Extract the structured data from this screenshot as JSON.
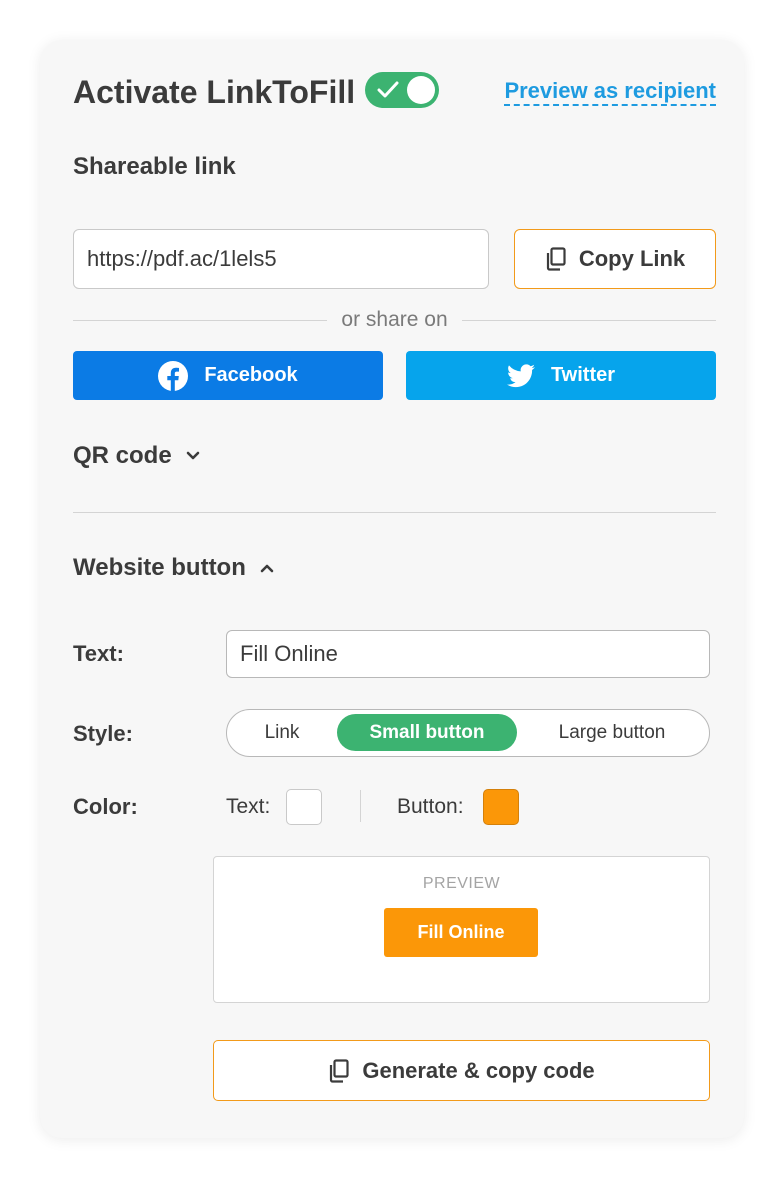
{
  "header": {
    "title": "Activate LinkToFill",
    "toggle_on": true,
    "preview_link": "Preview as recipient"
  },
  "shareable": {
    "heading": "Shareable link",
    "url": "https://pdf.ac/1lels5",
    "copy_label": "Copy Link",
    "or_share": "or share on",
    "facebook_label": "Facebook",
    "twitter_label": "Twitter"
  },
  "qr": {
    "heading": "QR code",
    "expanded": false
  },
  "website_button": {
    "heading": "Website button",
    "expanded": true,
    "text_label": "Text:",
    "text_value": "Fill Online",
    "style_label": "Style:",
    "style_options": [
      "Link",
      "Small button",
      "Large button"
    ],
    "style_selected": "Small button",
    "color_label": "Color:",
    "color_text_label": "Text:",
    "color_button_label": "Button:",
    "text_color": "#ffffff",
    "button_color": "#fb9708",
    "preview_title": "PREVIEW",
    "preview_button": "Fill Online",
    "generate_label": "Generate & copy code"
  },
  "colors": {
    "accent_green": "#3cb371",
    "link_blue": "#1e9be0",
    "facebook_blue": "#0b7be5",
    "twitter_blue": "#06a4ec",
    "orange_border": "#f29a1a"
  },
  "icons": {
    "copy": "copy-icon",
    "facebook": "facebook-icon",
    "twitter": "twitter-icon",
    "chevron_down": "chevron-down-icon",
    "chevron_up": "chevron-up-icon",
    "check": "check-icon"
  }
}
